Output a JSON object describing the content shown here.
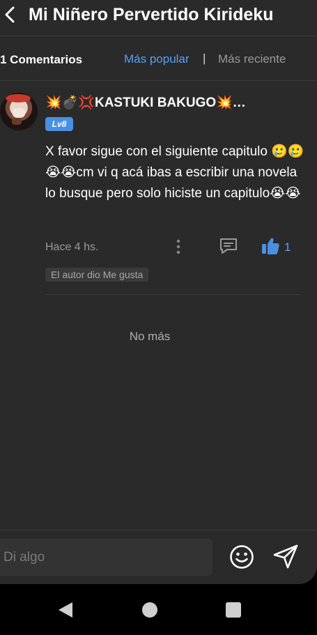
{
  "header": {
    "title": "Mi Niñero Pervertido Kirideku"
  },
  "sort": {
    "count_label": "1 Comentarios",
    "popular_label": "Más popular",
    "separator": "|",
    "recent_label": "Más reciente"
  },
  "comment": {
    "username": "💥💣💢KASTUKI BAKUGO💥…",
    "level": "Lv8",
    "text": "X favor sigue con el siguiente capitulo 🥲🥲😭😭cm vi q acá ibas a escribir una novela lo busque pero solo hiciste un capitulo😭😭",
    "time": "Hace 4 hs.",
    "likes": "1",
    "author_liked": "El autor dio Me gusta"
  },
  "list_end": "No más",
  "composer": {
    "placeholder": "Di algo"
  },
  "colors": {
    "accent": "#5aa0f2",
    "background": "#2a2a2a",
    "level_badge": "#4a90e2"
  },
  "icons": {
    "back": "chevron-left-icon",
    "more": "more-vertical-icon",
    "reply": "comment-icon",
    "like": "thumbs-up-icon",
    "emoji": "smiley-icon",
    "send": "send-icon"
  }
}
